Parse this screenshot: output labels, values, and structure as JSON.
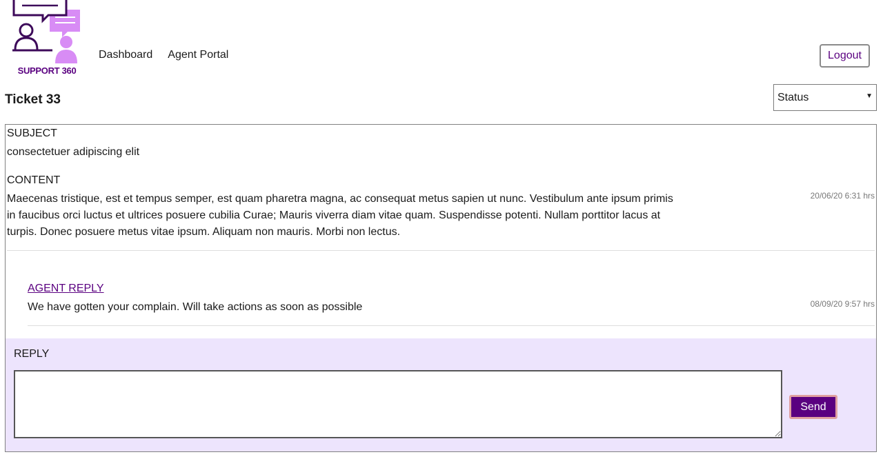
{
  "brand": {
    "logo_text": "SUPPORT 360",
    "primary_color": "#5a0080",
    "accent_color": "#d88cf5"
  },
  "nav": {
    "items": [
      "Dashboard",
      "Agent Portal"
    ],
    "logout_label": "Logout"
  },
  "ticket": {
    "title": "Ticket 33",
    "status_selected": "Status",
    "subject_label": "SUBJECT",
    "subject": "consectetuer adipiscing elit",
    "content_label": "CONTENT",
    "content": "Maecenas tristique, est et tempus semper, est quam pharetra magna, ac consequat metus sapien ut nunc. Vestibulum ante ipsum primis in faucibus orci luctus et ultrices posuere cubilia Curae; Mauris viverra diam vitae quam. Suspendisse potenti. Nullam porttitor lacus at turpis. Donec posuere metus vitae ipsum. Aliquam non mauris. Morbi non lectus.",
    "content_timestamp": "20/06/20 6:31 hrs"
  },
  "replies": [
    {
      "author": "AGENT REPLY",
      "text": "We have gotten your complain. Will take actions as soon as possible",
      "timestamp": "08/09/20 9:57 hrs"
    }
  ],
  "reply_form": {
    "label": "REPLY",
    "value": "",
    "send_label": "Send",
    "panel_color": "#ede4fd"
  }
}
